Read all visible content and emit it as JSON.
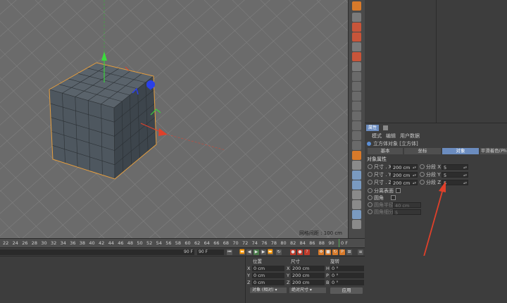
{
  "viewport": {
    "grid_spacing_label": "网格间距 : 100 cm"
  },
  "attributes": {
    "tab_label": "属性",
    "menu": [
      "模式",
      "编辑",
      "用户数据"
    ],
    "object_title": "立方体对象 [立方体]",
    "subtabs": [
      "基本",
      "坐标",
      "对象",
      "平滑着色(Ph"
    ],
    "active_subtab": "对象",
    "section_title": "对象属性",
    "size_x_label": "尺寸 . X",
    "size_y_label": "尺寸 . Y",
    "size_z_label": "尺寸 . Z",
    "size_x": "200 cm",
    "size_y": "200 cm",
    "size_z": "200 cm",
    "seg_x_label": "分段 X",
    "seg_y_label": "分段 Y",
    "seg_z_label": "分段 Z",
    "seg_x": "5",
    "seg_y": "5",
    "seg_z": "5",
    "separate_surfaces_label": "分离表面",
    "fillet_label": "圆角",
    "fillet_radius_label": "圆角半径",
    "fillet_radius": "40 cm",
    "fillet_subdiv_label": "圆角细分",
    "fillet_subdiv": "5"
  },
  "timeline": {
    "ticks": [
      "22",
      "24",
      "26",
      "28",
      "30",
      "32",
      "34",
      "36",
      "38",
      "40",
      "42",
      "44",
      "46",
      "48",
      "50",
      "52",
      "54",
      "56",
      "58",
      "60",
      "62",
      "64",
      "66",
      "68",
      "70",
      "72",
      "74",
      "76",
      "78",
      "80",
      "82",
      "84",
      "86",
      "88",
      "90"
    ],
    "end_frame": "0 F"
  },
  "playback": {
    "current_frame": "90 F",
    "max_frame": "90 F"
  },
  "coordinates": {
    "headers": {
      "position": "位置",
      "size": "尺寸",
      "rotation": "旋转"
    },
    "rows": [
      {
        "axis": "X",
        "pos": "0 cm",
        "size_axis": "X",
        "size": "200 cm",
        "rot_axis": "H",
        "rot": "0 °"
      },
      {
        "axis": "Y",
        "pos": "0 cm",
        "size_axis": "Y",
        "size": "200 cm",
        "rot_axis": "P",
        "rot": "0 °"
      },
      {
        "axis": "Z",
        "pos": "0 cm",
        "size_axis": "Z",
        "size": "200 cm",
        "rot_axis": "B",
        "rot": "0 °"
      }
    ],
    "mode_dropdown": "对象 (相对)",
    "size_dropdown": "绝对尺寸",
    "apply_label": "应用"
  },
  "colors": {
    "accent": "#6b8cbf",
    "viewport_bg": "#6b6b6b",
    "cube_face": "#4a535b",
    "selection_outline": "#e8a040",
    "arrow": "#e0402a"
  }
}
